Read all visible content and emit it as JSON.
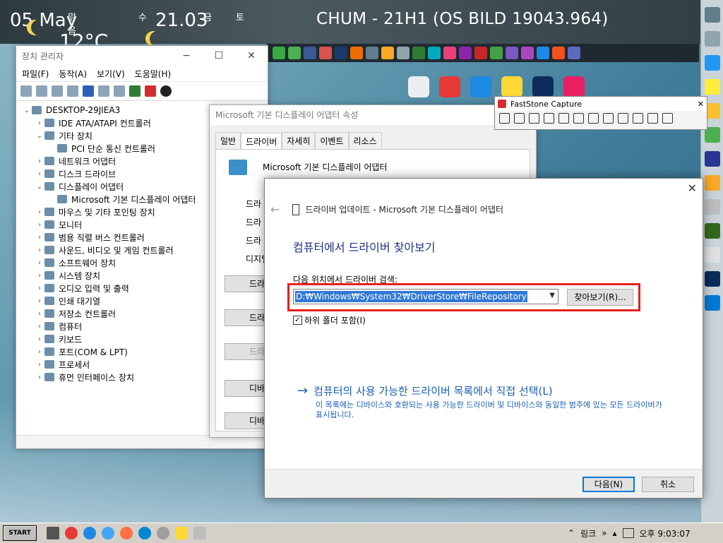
{
  "desktop": {
    "title": "CHUM - 21H1 (OS BILD 19043.964)",
    "date": "05 May",
    "time": "21.03",
    "temperature": "12°C",
    "day_labels": [
      "맑음",
      "수",
      "금",
      "토"
    ]
  },
  "device_manager": {
    "title": "장치 관리자",
    "controls": [
      "−",
      "☐",
      "✕"
    ],
    "menu": [
      "파일(F)",
      "동작(A)",
      "보기(V)",
      "도움말(H)"
    ],
    "tree": [
      {
        "label": "DESKTOP-29JIEA3",
        "indent": 0,
        "exp": "⌄",
        "icon": "computer-icon"
      },
      {
        "label": "IDE ATA/ATAPI 컨트롤러",
        "indent": 1,
        "exp": "›",
        "icon": "ide-controller-icon"
      },
      {
        "label": "기타 장치",
        "indent": 1,
        "exp": "⌄",
        "icon": "unknown-device-icon"
      },
      {
        "label": "PCI 단순 통신 컨트롤러",
        "indent": 2,
        "exp": "",
        "icon": "warning-device-icon"
      },
      {
        "label": "네트워크 어댑터",
        "indent": 1,
        "exp": "›",
        "icon": "network-adapter-icon"
      },
      {
        "label": "디스크 드라이브",
        "indent": 1,
        "exp": "›",
        "icon": "disk-drive-icon"
      },
      {
        "label": "디스플레이 어댑터",
        "indent": 1,
        "exp": "⌄",
        "icon": "display-adapter-icon"
      },
      {
        "label": "Microsoft 기본 디스플레이 어댑터",
        "indent": 2,
        "exp": "",
        "icon": "display-adapter-icon"
      },
      {
        "label": "마우스 및 기타 포인팅 장치",
        "indent": 1,
        "exp": "›",
        "icon": "mouse-icon"
      },
      {
        "label": "모니터",
        "indent": 1,
        "exp": "›",
        "icon": "monitor-icon"
      },
      {
        "label": "범용 직렬 버스 컨트롤러",
        "indent": 1,
        "exp": "›",
        "icon": "usb-icon"
      },
      {
        "label": "사운드, 비디오 및 게임 컨트롤러",
        "indent": 1,
        "exp": "›",
        "icon": "sound-icon"
      },
      {
        "label": "소프트웨어 장치",
        "indent": 1,
        "exp": "›",
        "icon": "software-device-icon"
      },
      {
        "label": "시스템 장치",
        "indent": 1,
        "exp": "›",
        "icon": "system-device-icon"
      },
      {
        "label": "오디오 입력 및 출력",
        "indent": 1,
        "exp": "›",
        "icon": "audio-io-icon"
      },
      {
        "label": "인쇄 대기열",
        "indent": 1,
        "exp": "›",
        "icon": "print-queue-icon"
      },
      {
        "label": "저장소 컨트롤러",
        "indent": 1,
        "exp": "›",
        "icon": "storage-controller-icon"
      },
      {
        "label": "컴퓨터",
        "indent": 1,
        "exp": "›",
        "icon": "computer-icon"
      },
      {
        "label": "키보드",
        "indent": 1,
        "exp": "›",
        "icon": "keyboard-icon"
      },
      {
        "label": "포트(COM & LPT)",
        "indent": 1,
        "exp": "›",
        "icon": "port-icon"
      },
      {
        "label": "프로세서",
        "indent": 1,
        "exp": "›",
        "icon": "processor-icon"
      },
      {
        "label": "휴먼 인터페이스 장치",
        "indent": 1,
        "exp": "›",
        "icon": "hid-icon"
      }
    ]
  },
  "properties": {
    "title": "Microsoft 기본 디스플레이 어댑터 속성",
    "tabs": [
      "일반",
      "드라이버",
      "자세히",
      "이벤트",
      "리소스"
    ],
    "device_name": "Microsoft 기본 디스플레이 어댑터",
    "partial_labels": [
      "드라",
      "드라",
      "드라",
      "디지털"
    ],
    "partial_buttons": [
      "드라",
      "드라이",
      "드라",
      "디바이스",
      "디바"
    ]
  },
  "faststone": {
    "title": "FastStone Capture",
    "close": "✕"
  },
  "update_dialog": {
    "header": "드라이버 업데이트 - Microsoft 기본 디스플레이 어댑터",
    "heading": "컴퓨터에서 드라이버 찾아보기",
    "search_label": "다음 위치에서 드라이버 검색:",
    "path_value": "D:₩Windows₩System32₩DriverStore₩FileRepository",
    "browse_label": "찾아보기(R)...",
    "include_subfolders_label": "하위 폴더 포함(I)",
    "link_label": "컴퓨터의 사용 가능한 드라이버 목록에서 직접 선택(L)",
    "link_desc": "이 목록에는 디바이스와 호환되는 사용 가능한 드라이버 및 디바이스와 동일한 범주에 있는 모든 드라이버가 표시됩니다.",
    "next_label": "다음(N)",
    "cancel_label": "취소",
    "close": "✕",
    "back": "←"
  },
  "taskbar": {
    "start_label": "START",
    "tray_link": "링크",
    "tray_more": "»",
    "clock": "오후 9:03:07"
  }
}
